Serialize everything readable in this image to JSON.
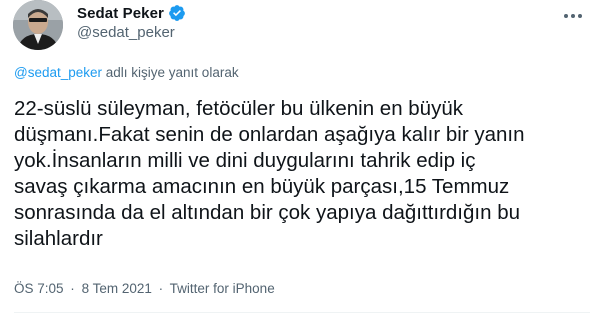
{
  "author": {
    "display_name": "Sedat Peker",
    "handle": "@sedat_peker",
    "verified_icon": "verified-badge-icon",
    "verified_color": "#1d9bf0"
  },
  "reply_context": {
    "mention": "@sedat_peker",
    "suffix": " adlı kişiye yanıt olarak"
  },
  "tweet_text_lines": [
    "22-süslü süleyman, fetöcüler bu ülkenin en büyük",
    "düşmanı.Fakat senin de onlardan aşağıya kalır bir yanın",
    "yok.İnsanların milli ve dini duygularını tahrik edip iç",
    "savaş çıkarma amacının en büyük parçası,15 Temmuz",
    "sonrasında da el altından bir çok yapıya dağıttırdığın bu",
    "silahlardır"
  ],
  "meta": {
    "time": "ÖS 7:05",
    "separator": "·",
    "date": "8 Tem 2021",
    "source": "Twitter for iPhone"
  },
  "icons": {
    "more": "more-horizontal-icon",
    "avatar": "avatar"
  },
  "colors": {
    "text_primary": "#0f1419",
    "text_secondary": "#536471",
    "link": "#1d9bf0",
    "divider": "#eff3f4"
  }
}
